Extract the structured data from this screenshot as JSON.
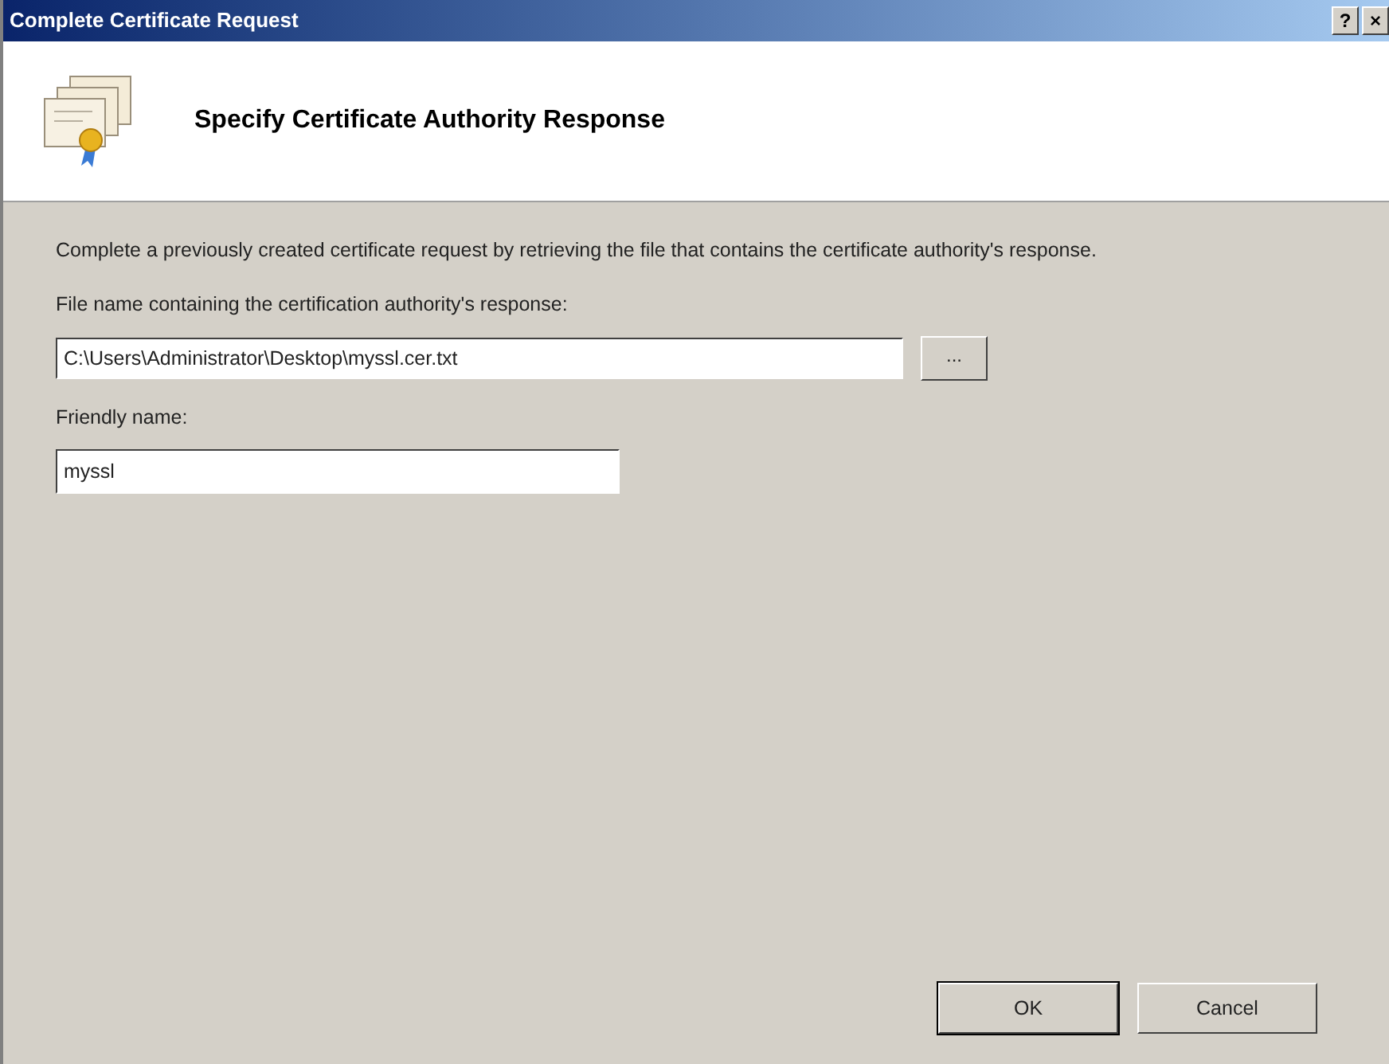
{
  "window": {
    "title": "Complete Certificate Request",
    "title_buttons": [
      "?",
      "×"
    ]
  },
  "header": {
    "title": "Specify Certificate Authority Response"
  },
  "description": "Complete a previously created certificate request by retrieving the file that contains the certificate authority's response.",
  "file_field": {
    "label": "File name containing the certification authority's response:",
    "value": "C:\\Users\\Administrator\\Desktop\\myssl.cer.txt",
    "browse_button": "..."
  },
  "friendly_field": {
    "label": "Friendly name:",
    "value": "myssl"
  },
  "buttons": [
    {
      "label": "OK",
      "default": true
    },
    {
      "label": "Cancel",
      "default": false
    }
  ]
}
